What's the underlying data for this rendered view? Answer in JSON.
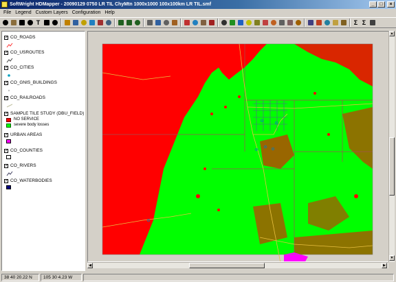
{
  "window": {
    "title": "SoftWright HDMapper - 20090129 0750 LR TIL ChyMtn 1000x1000 100x100km LR TIL.smf",
    "minimize": "_",
    "maximize": "□",
    "close": "×"
  },
  "menu": [
    "File",
    "Legend",
    "Custom Layers",
    "Configuration",
    "Help"
  ],
  "toolbar_icons": [
    "zoom-icon",
    "pan-hand-icon",
    "info-icon",
    "identify-icon",
    "text-tool-icon",
    "draw-line-icon",
    "pointer-icon",
    "pencil-icon",
    "select-icon",
    "open-file-icon",
    "layer-icon",
    "edit-icon",
    "grid-icon",
    "zoom-in-icon",
    "zoom-out-icon",
    "zoom-extent-icon",
    "print-icon",
    "save-icon",
    "copy-icon",
    "export-icon",
    "measure-icon",
    "route-icon",
    "profile-icon",
    "tile-icon",
    "dbf-icon",
    "coverage-icon",
    "site-icon",
    "color-icon",
    "terrain-icon",
    "antenna-icon",
    "flag-icon",
    "link-icon",
    "radio-icon",
    "signal-icon",
    "map-icon",
    "study-icon",
    "layers2-icon",
    "palette-icon",
    "grid2-icon",
    "sigma-icon",
    "sum-icon",
    "table-icon"
  ],
  "legend": {
    "layers": [
      {
        "name": "CO_ROADS",
        "checked": true,
        "symbol": "road-line"
      },
      {
        "name": "CO_USROUTES",
        "checked": true,
        "symbol": "route-line"
      },
      {
        "name": "CO_CITIES",
        "checked": true,
        "symbol": "city-dot"
      },
      {
        "name": "CO_GNIS_BUILDINGS",
        "checked": true,
        "symbol": "building-dot"
      },
      {
        "name": "CO_RAILROADS",
        "checked": true,
        "symbol": "rail-line"
      },
      {
        "name": "SAMPLE TILE STUDY (DBU_FIELD)",
        "checked": true,
        "symbol": "study"
      },
      {
        "name": "URBAN AREAS",
        "checked": true,
        "symbol": "urban-box"
      },
      {
        "name": "CO_COUNTIES",
        "checked": true,
        "symbol": "county-box"
      },
      {
        "name": "CO_RIVERS",
        "checked": true,
        "symbol": "river-line"
      },
      {
        "name": "CO_WATERBODIES",
        "checked": true,
        "symbol": "water-box"
      }
    ],
    "study_classes": [
      {
        "label": "NO SERVICE",
        "color": "#ff0000"
      },
      {
        "label": "severe body losses",
        "color": "#00ff00"
      }
    ]
  },
  "colors": {
    "no_service": "#ff0000",
    "severe_body_losses": "#00ff00",
    "urban": "#ff00ff",
    "water": "#000080",
    "road": "#e8c040",
    "county": "#a05050"
  },
  "status": {
    "latitude": "38 40 20.22 N",
    "longitude": "105 30 4.23 W"
  }
}
